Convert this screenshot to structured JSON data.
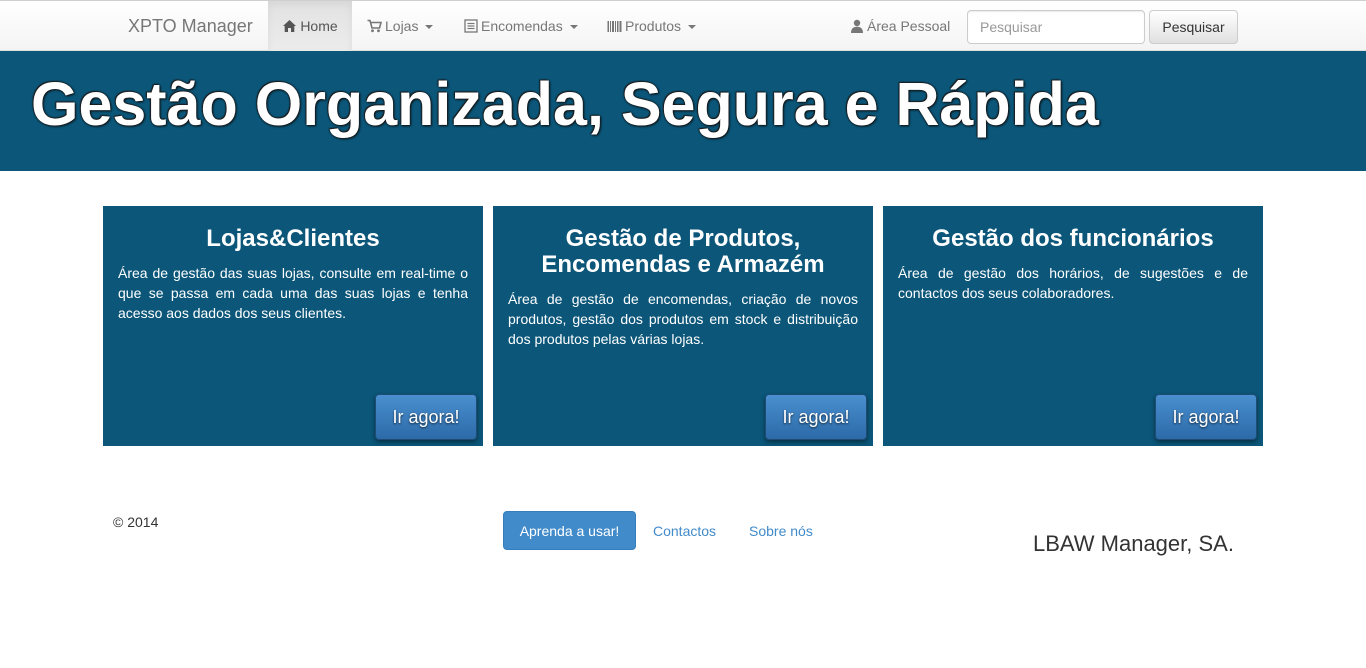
{
  "navbar": {
    "brand": "XPTO Manager",
    "items": [
      {
        "label": "Home",
        "icon": "home-icon"
      },
      {
        "label": "Lojas",
        "icon": "cart-icon"
      },
      {
        "label": "Encomendas",
        "icon": "list-icon"
      },
      {
        "label": "Produtos",
        "icon": "barcode-icon"
      }
    ],
    "personal_area": {
      "label": "Área Pessoal",
      "icon": "user-icon"
    },
    "search": {
      "placeholder": "Pesquisar",
      "value": "",
      "button_label": "Pesquisar"
    }
  },
  "hero": {
    "title": "Gestão Organizada, Segura e Rápida"
  },
  "cards": [
    {
      "title": "Lojas&Clientes",
      "text": "Área de gestão das suas lojas, consulte em real-time o que se passa em cada uma das suas lojas e tenha acesso aos dados dos seus clientes.",
      "button_label": "Ir agora!"
    },
    {
      "title": "Gestão de Produtos, Encomendas e Armazém",
      "text": "Área de gestão de encomendas, criação de novos produtos, gestão dos produtos em stock e distribuição dos produtos pelas várias lojas.",
      "button_label": "Ir agora!"
    },
    {
      "title": "Gestão dos funcionários",
      "text": "Área de gestão dos horários, de sugestões e de contactos dos seus colaboradores.",
      "button_label": "Ir agora!"
    }
  ],
  "footer": {
    "copyright": "© 2014",
    "learn_button": "Aprenda a usar!",
    "links": [
      "Contactos",
      "Sobre nós"
    ],
    "company": "LBAW Manager, SA."
  },
  "colors": {
    "primary_dark": "#0b5679",
    "link": "#428bca",
    "button_primary": "#428bca"
  }
}
